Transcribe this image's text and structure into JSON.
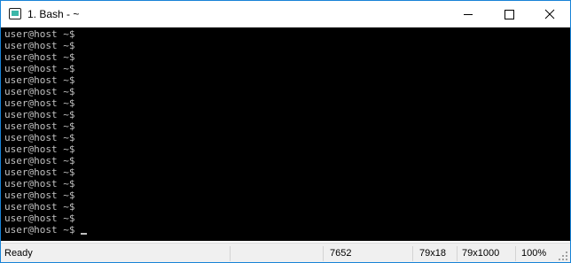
{
  "window": {
    "title": "1. Bash - ~",
    "app_icon": "terminal-app-icon",
    "caption_buttons": [
      "minimize-icon",
      "maximize-icon",
      "close-icon"
    ]
  },
  "terminal": {
    "background": "#000000",
    "foreground": "#c0c0c0",
    "lines": [
      "user@host ~$",
      "user@host ~$",
      "user@host ~$",
      "user@host ~$",
      "user@host ~$",
      "user@host ~$",
      "user@host ~$",
      "user@host ~$",
      "user@host ~$",
      "user@host ~$",
      "user@host ~$",
      "user@host ~$",
      "user@host ~$",
      "user@host ~$",
      "user@host ~$",
      "user@host ~$",
      "user@host ~$",
      "user@host ~$"
    ]
  },
  "statusbar": {
    "ready": "Ready",
    "blank": "",
    "counter": "7652",
    "size": "79x18",
    "buffer": "79x1000",
    "zoom": "100%"
  }
}
